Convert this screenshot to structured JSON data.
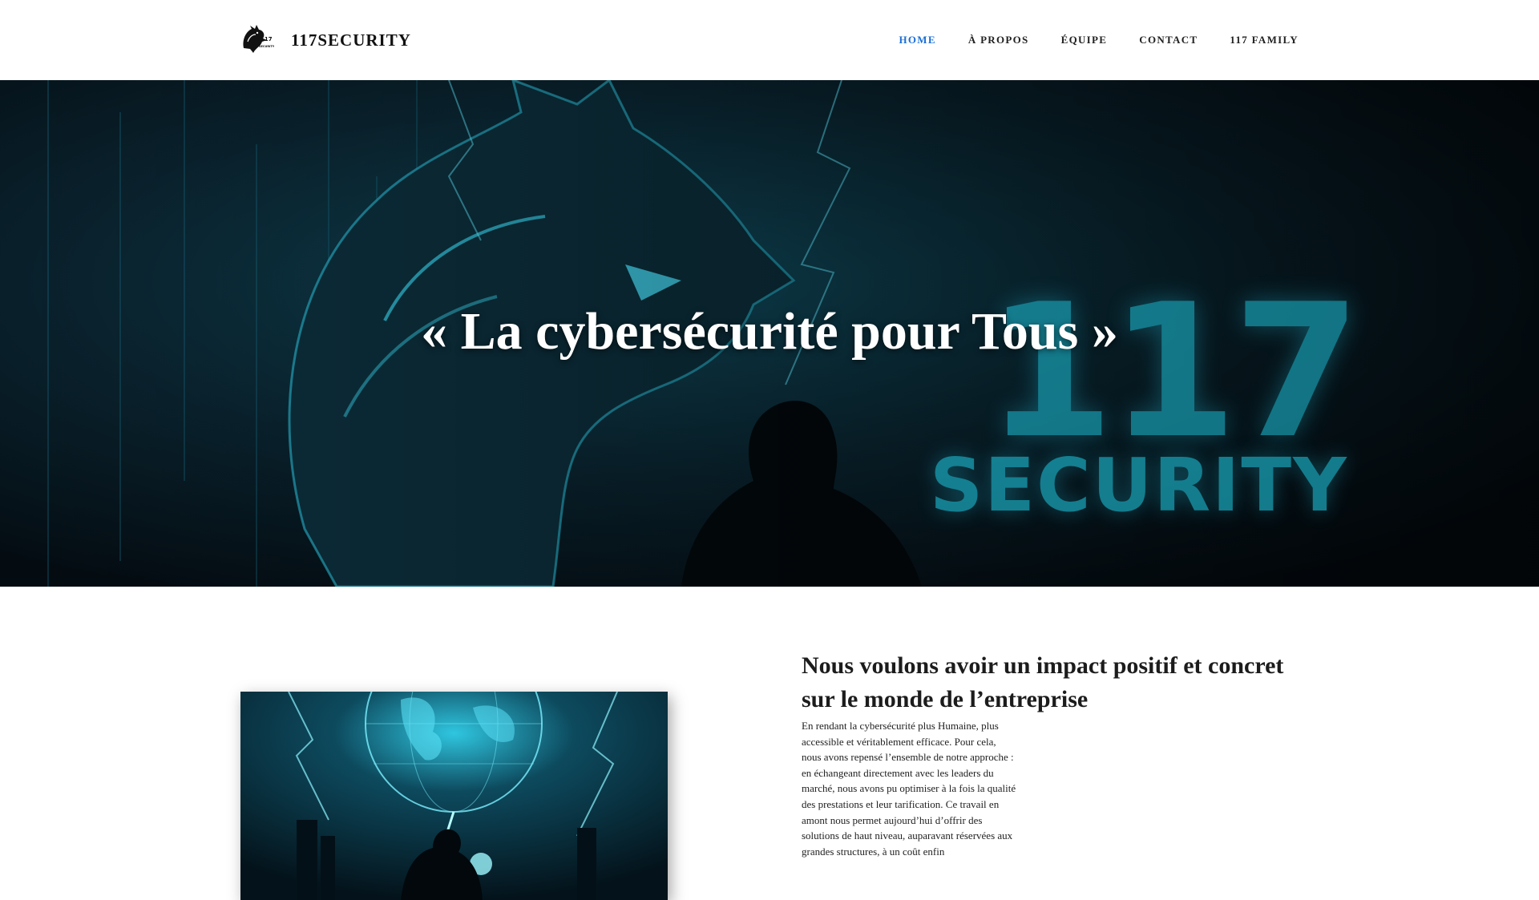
{
  "header": {
    "brand_name": "117SECURITY",
    "logo_icon": "wolf-logo-icon",
    "nav": [
      {
        "label": "HOME",
        "active": true
      },
      {
        "label": "À PROPOS",
        "active": false
      },
      {
        "label": "ÉQUIPE",
        "active": false
      },
      {
        "label": "CONTACT",
        "active": false
      },
      {
        "label": "117 FAMILY",
        "active": false
      }
    ]
  },
  "hero": {
    "quote": "« La cybersécurité pour Tous »",
    "brand_number": "117",
    "brand_word": "SECURITY"
  },
  "about": {
    "heading": "Nous voulons avoir un impact positif et concret sur le monde de l’entreprise",
    "paragraph": "En rendant la cybersécurité plus Humaine, plus accessible et véritablement efficace. Pour cela, nous avons repensé l’ensemble de notre approche : en échangeant directement avec les leaders du marché, nous avons pu optimiser à la fois la qualité des prestations et leur tarification. Ce travail en amont nous permet aujourd’hui d’offrir des solutions de haut niveau, auparavant réservées aux grandes structures, à un coût enfin"
  },
  "colors": {
    "accent": "#1a6fd6",
    "hero_glow": "#1ec6de",
    "text": "#222222"
  }
}
